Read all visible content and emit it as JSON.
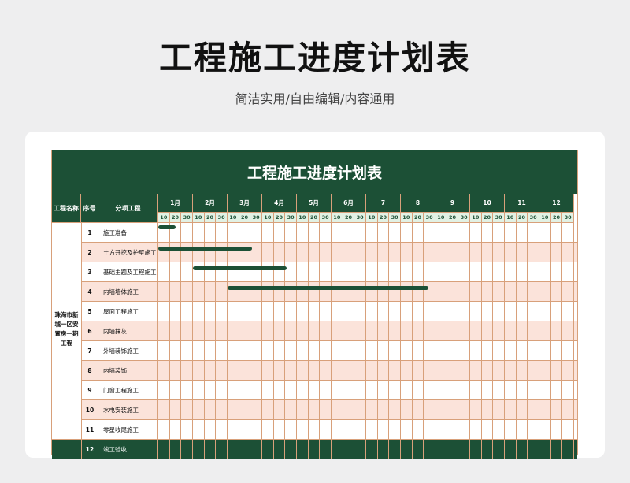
{
  "page": {
    "title": "工程施工进度计划表",
    "subtitle": "简洁实用/自由编辑/内容通用"
  },
  "sheet": {
    "title": "工程施工进度计划表",
    "headers": {
      "project": "工程名称",
      "index": "序号",
      "item": "分项工程"
    },
    "project_name": "珠海市新城一区安置房一期工程",
    "months": [
      "1月",
      "2月",
      "3月",
      "4月",
      "5月",
      "6月",
      "7",
      "8",
      "9",
      "10",
      "11",
      "12"
    ],
    "days": [
      "10",
      "20",
      "30"
    ],
    "rows": [
      {
        "idx": "1",
        "name": "施工准备",
        "start": 0.0,
        "end": 0.5
      },
      {
        "idx": "2",
        "name": "土方开挖及护壁施工",
        "start": 0.0,
        "end": 2.7
      },
      {
        "idx": "3",
        "name": "基础主题及工程施工",
        "start": 1.0,
        "end": 3.7
      },
      {
        "idx": "4",
        "name": "内墙墙体施工",
        "start": 2.0,
        "end": 7.8
      },
      {
        "idx": "5",
        "name": "屋面工程施工"
      },
      {
        "idx": "6",
        "name": "内墙抹灰"
      },
      {
        "idx": "7",
        "name": "外墙装饰施工"
      },
      {
        "idx": "8",
        "name": "内墙装饰"
      },
      {
        "idx": "9",
        "name": "门窗工程施工"
      },
      {
        "idx": "10",
        "name": "水电安装施工"
      },
      {
        "idx": "11",
        "name": "零星收尾施工"
      },
      {
        "idx": "12",
        "name": "竣工验收"
      }
    ],
    "colors": {
      "header_green": "#1c5036",
      "day_green": "#e2f1e4",
      "pink_row": "#fbe3da",
      "border": "#d8a07a"
    }
  }
}
